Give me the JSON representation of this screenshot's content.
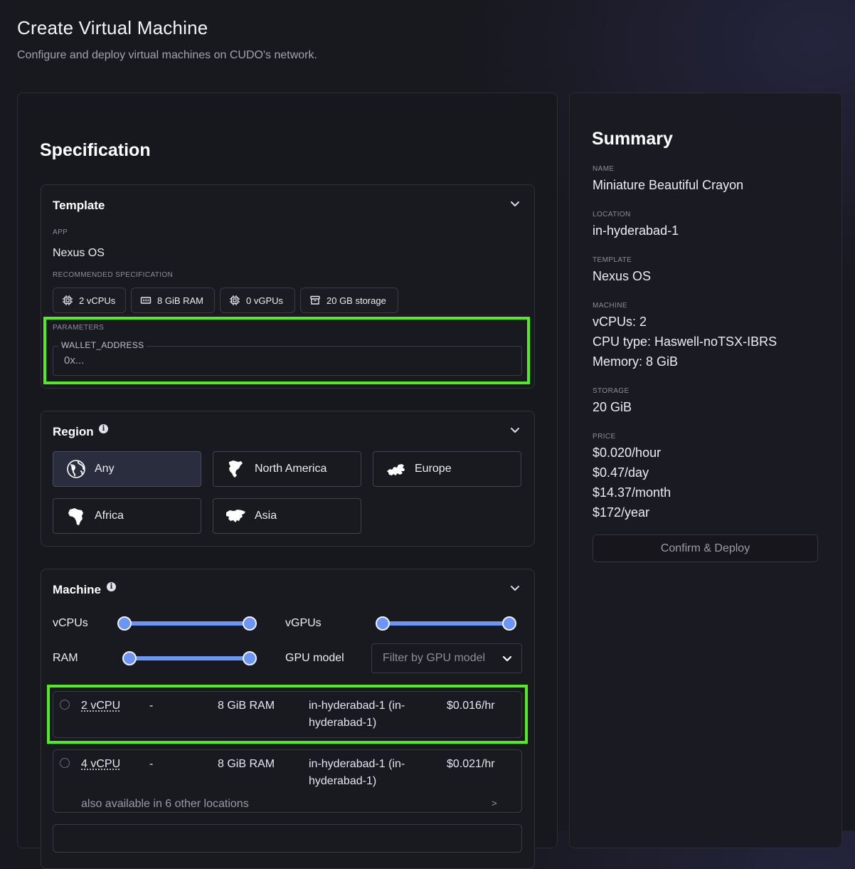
{
  "page": {
    "title": "Create Virtual Machine",
    "subtitle": "Configure and deploy virtual machines on CUDO's network."
  },
  "specification": {
    "heading": "Specification",
    "template": {
      "title": "Template",
      "app_label": "APP",
      "app_value": "Nexus OS",
      "recommended_label": "RECOMMENDED SPECIFICATION",
      "chips": [
        "2 vCPUs",
        "8 GiB RAM",
        "0 vGPUs",
        "20 GB storage"
      ],
      "parameters_label": "PARAMETERS",
      "wallet_label": "WALLET_ADDRESS",
      "wallet_placeholder": "0x..."
    },
    "region": {
      "title": "Region",
      "info": "i",
      "options": [
        "Any",
        "North America",
        "Europe",
        "Africa",
        "Asia"
      ],
      "selected": "Any"
    },
    "machine": {
      "title": "Machine",
      "info": "i",
      "vcpus_label": "vCPUs",
      "vgpus_label": "vGPUs",
      "ram_label": "RAM",
      "gpu_model_label": "GPU model",
      "gpu_model_placeholder": "Filter by GPU model",
      "rows": [
        {
          "cpu": "2 vCPU",
          "gpu": "-",
          "ram": "8 GiB RAM",
          "location_line1": "in-hyderabad-1 (in-",
          "location_line2": "hyderabad-1)",
          "price": "$0.016/hr"
        },
        {
          "cpu": "4 vCPU",
          "gpu": "-",
          "ram": "8 GiB RAM",
          "location_line1": "in-hyderabad-1 (in-",
          "location_line2": "hyderabad-1)",
          "price": "$0.021/hr",
          "also": "also available in 6 other locations",
          "more": ">"
        }
      ]
    }
  },
  "summary": {
    "heading": "Summary",
    "name_label": "NAME",
    "name": "Miniature Beautiful Crayon",
    "location_label": "LOCATION",
    "location": "in-hyderabad-1",
    "template_label": "TEMPLATE",
    "template": "Nexus OS",
    "machine_label": "MACHINE",
    "machine_vcpus": "vCPUs: 2",
    "machine_cpu_type": "CPU type: Haswell-noTSX-IBRS",
    "machine_memory": "Memory: 8 GiB",
    "storage_label": "STORAGE",
    "storage": "20 GiB",
    "price_label": "PRICE",
    "price_hour": "$0.020/hour",
    "price_day": "$0.47/day",
    "price_month": "$14.37/month",
    "price_year": "$172/year",
    "deploy_button": "Confirm & Deploy"
  },
  "colors": {
    "highlight": "#54ea24",
    "slider": "#6b96f5",
    "background": "#18181f"
  },
  "icons": [
    "cpu-chip-icon",
    "memory-icon",
    "gpu-chip-icon",
    "storage-archive-icon",
    "globe-icon",
    "north-america-icon",
    "europe-icon",
    "africa-icon",
    "asia-icon",
    "chevron-down-icon",
    "info-icon"
  ]
}
